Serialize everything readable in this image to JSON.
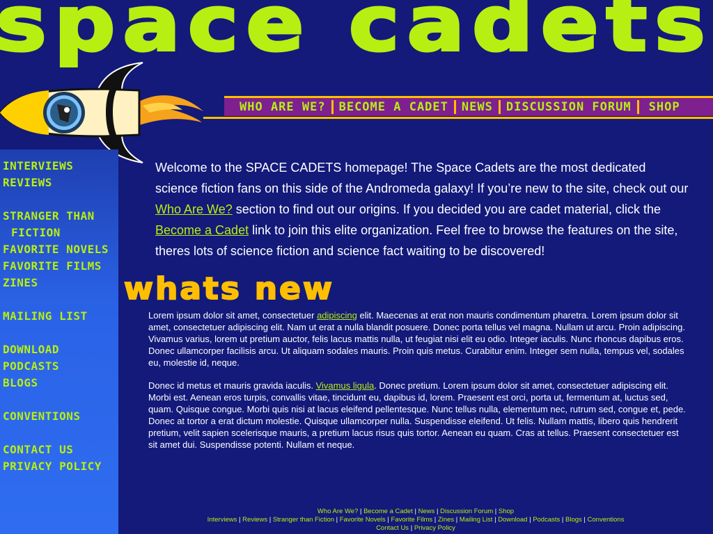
{
  "site": {
    "title": "SPACE CADETS"
  },
  "nav": {
    "items": [
      "WHO ARE WE?",
      "BECOME A CADET",
      "NEWS",
      "DISCUSSION FORUM",
      "SHOP"
    ]
  },
  "sidebar": {
    "items": [
      "INTERVIEWS",
      "REVIEWS",
      "STRANGER THAN",
      "FICTION",
      "FAVORITE NOVELS",
      "FAVORITE FILMS",
      "ZINES",
      "MAILING LIST",
      "DOWNLOAD",
      "PODCASTS",
      "BLOGS",
      "CONVENTIONS",
      "CONTACT US",
      "PRIVACY POLICY"
    ]
  },
  "intro": {
    "p1": "Welcome to the SPACE CADETS homepage!  The Space Cadets are the most dedicated science fiction fans on this side of the Andromeda galaxy!  If you’re new to the site, check out our ",
    "link1": "Who Are We?",
    "p2": " section to find out our origins.  If you decided you are cadet material, click the ",
    "link2": "Become a Cadet",
    "p3": " link to join this elite organization.  Feel free to browse the features on the site, theres lots of science fiction and science fact waiting to be discovered!"
  },
  "whats_new": {
    "heading": "whats new"
  },
  "content": {
    "para1_a": "Lorem ipsum dolor sit amet, consectetuer ",
    "para1_link": "adipiscing",
    "para1_b": " elit. Maecenas at erat non mauris condimentum pharetra. Lorem ipsum dolor sit amet, consectetuer adipiscing elit. Nam ut erat a nulla blandit posuere. Donec porta tellus vel magna. Nullam ut arcu. Proin adipiscing. Vivamus varius, lorem ut pretium auctor, felis lacus mattis nulla, ut feugiat nisi elit eu odio. Integer iaculis. Nunc rhoncus dapibus eros. Donec ullamcorper facilisis arcu. Ut aliquam sodales mauris. Proin quis metus. Curabitur enim. Integer sem nulla, tempus vel, sodales eu, molestie id, neque.",
    "para2_a": "Donec id metus et mauris gravida iaculis. ",
    "para2_link": "Vivamus ligula",
    "para2_b": ". Donec pretium. Lorem ipsum dolor sit amet, consectetuer adipiscing elit. Morbi est. Aenean eros turpis, convallis vitae, tincidunt eu, dapibus id, lorem. Praesent est orci, porta ut, fermentum at, luctus sed, quam. Quisque congue. Morbi quis nisi at lacus eleifend pellentesque. Nunc tellus nulla, elementum nec, rutrum sed, congue et, pede. Donec at tortor a erat dictum molestie. Quisque ullamcorper nulla. Suspendisse eleifend. Ut felis. Nullam mattis, libero quis hendrerit pretium, velit sapien scelerisque mauris, a pretium lacus risus quis tortor. Aenean eu quam. Cras at tellus. Praesent consectetuer est sit amet dui. Suspendisse potenti. Nullam et neque."
  },
  "footer": {
    "row1": [
      "Who Are We?",
      "Become a Cadet",
      "News",
      "Discussion Forum",
      "Shop"
    ],
    "row2": [
      "Interviews",
      "Reviews",
      "Stranger than Fiction",
      "Favorite Novels",
      "Favorite Films",
      "Zines",
      "Mailing List",
      "Download",
      "Podcasts",
      "Blogs",
      "Conventions"
    ],
    "row3": [
      "Contact Us",
      "Privacy Policy"
    ],
    "separator": " | "
  },
  "colors": {
    "background": "#131a7a",
    "accent": "#b8ef12",
    "nav_bg": "#7e208f",
    "gold": "#ffbf00",
    "sidebar": "#2a62e6"
  }
}
